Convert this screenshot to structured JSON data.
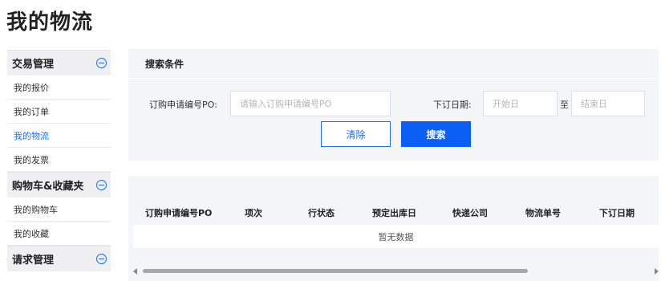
{
  "page": {
    "title": "我的物流"
  },
  "sidebar": {
    "groups": [
      {
        "label": "交易管理",
        "items": [
          "我的报价",
          "我的订单",
          "我的物流",
          "我的发票"
        ]
      },
      {
        "label": "购物车&收藏夹",
        "items": [
          "我的购物车",
          "我的收藏"
        ]
      },
      {
        "label": "请求管理",
        "items": []
      }
    ],
    "active_item": "我的物流",
    "collapse_icon": "minus-circle-icon",
    "accent_color": "#1d6ef5"
  },
  "search": {
    "section_title": "搜索条件",
    "po_label": "订购申请编号PO:",
    "po_placeholder": "请输入订购申请编号PO",
    "date_label": "下订日期:",
    "start_placeholder": "开始日",
    "range_sep": "至",
    "end_placeholder": "结束日",
    "clear_label": "清除",
    "search_label": "搜索"
  },
  "table": {
    "columns": [
      "订购申请编号PO",
      "项次",
      "行状态",
      "预定出库日",
      "快递公司",
      "物流单号",
      "下订日期"
    ],
    "empty_text": "暂无数据"
  }
}
